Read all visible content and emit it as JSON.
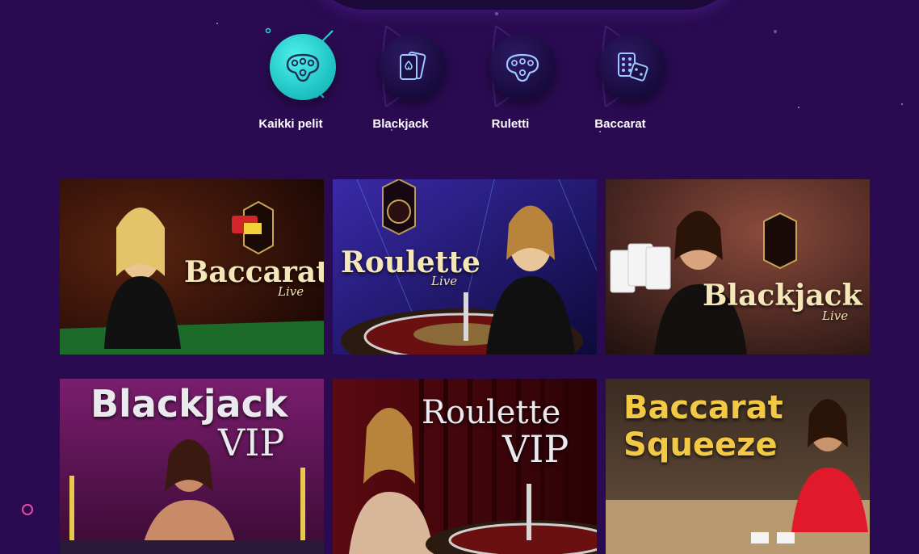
{
  "categories": [
    {
      "label": "Kaikki pelit",
      "icon": "roulette-icon",
      "active": true
    },
    {
      "label": "Blackjack",
      "icon": "cards-icon",
      "active": false
    },
    {
      "label": "Ruletti",
      "icon": "roulette-icon",
      "active": false
    },
    {
      "label": "Baccarat",
      "icon": "dice-icon",
      "active": false
    }
  ],
  "games": [
    {
      "title": "Baccarat",
      "subtitle": "Live"
    },
    {
      "title": "Roulette",
      "subtitle": "Live"
    },
    {
      "title": "Blackjack",
      "subtitle": "Live"
    },
    {
      "title": "Blackjack",
      "subtitle": "VIP"
    },
    {
      "title": "Roulette",
      "subtitle": "VIP"
    },
    {
      "title": "Baccarat",
      "subtitle": "Squeeze"
    }
  ],
  "colors": {
    "background": "#2a0b52",
    "active_category": "#21c6c6",
    "chat_ring": "#e84aa8"
  }
}
